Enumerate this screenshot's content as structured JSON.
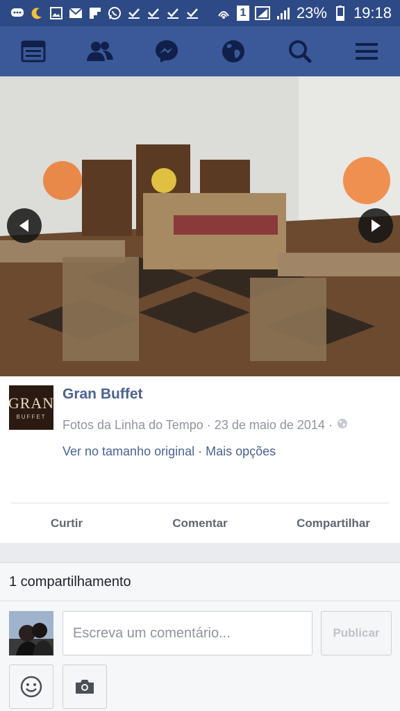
{
  "status_bar": {
    "battery": "23%",
    "time": "19:18",
    "sim_badge": "1",
    "left_icons": [
      "chat-icon",
      "moon-icon",
      "gallery-icon",
      "mail-icon",
      "flipboard-icon",
      "whatsapp-icon",
      "check-icon",
      "check-icon",
      "check-icon",
      "check-icon"
    ],
    "right_icons": [
      "vibrate-icon",
      "sim-icon",
      "signal-icon",
      "battery-icon"
    ]
  },
  "nav": {
    "items": [
      "news-feed-icon",
      "friends-icon",
      "messenger-icon",
      "globe-icon",
      "search-icon",
      "menu-icon"
    ]
  },
  "post": {
    "page_name": "Gran Buffet",
    "logo_word": "GRAN",
    "logo_sub": "BUFFET",
    "meta_text": "Fotos da Linha do Tempo · 23 de maio de 2014 ·",
    "view_original": "Ver no tamanho original",
    "link_separator": " · ",
    "more_options": "Mais opções"
  },
  "actions": {
    "like": "Curtir",
    "comment": "Comentar",
    "share": "Compartilhar"
  },
  "shares": {
    "count_text": "1 compartilhamento"
  },
  "comment": {
    "placeholder": "Escreva um comentário...",
    "publish": "Publicar"
  },
  "colors": {
    "status_bar": "#2e4a86",
    "nav_bar": "#3b5998",
    "link": "#4b6294"
  }
}
